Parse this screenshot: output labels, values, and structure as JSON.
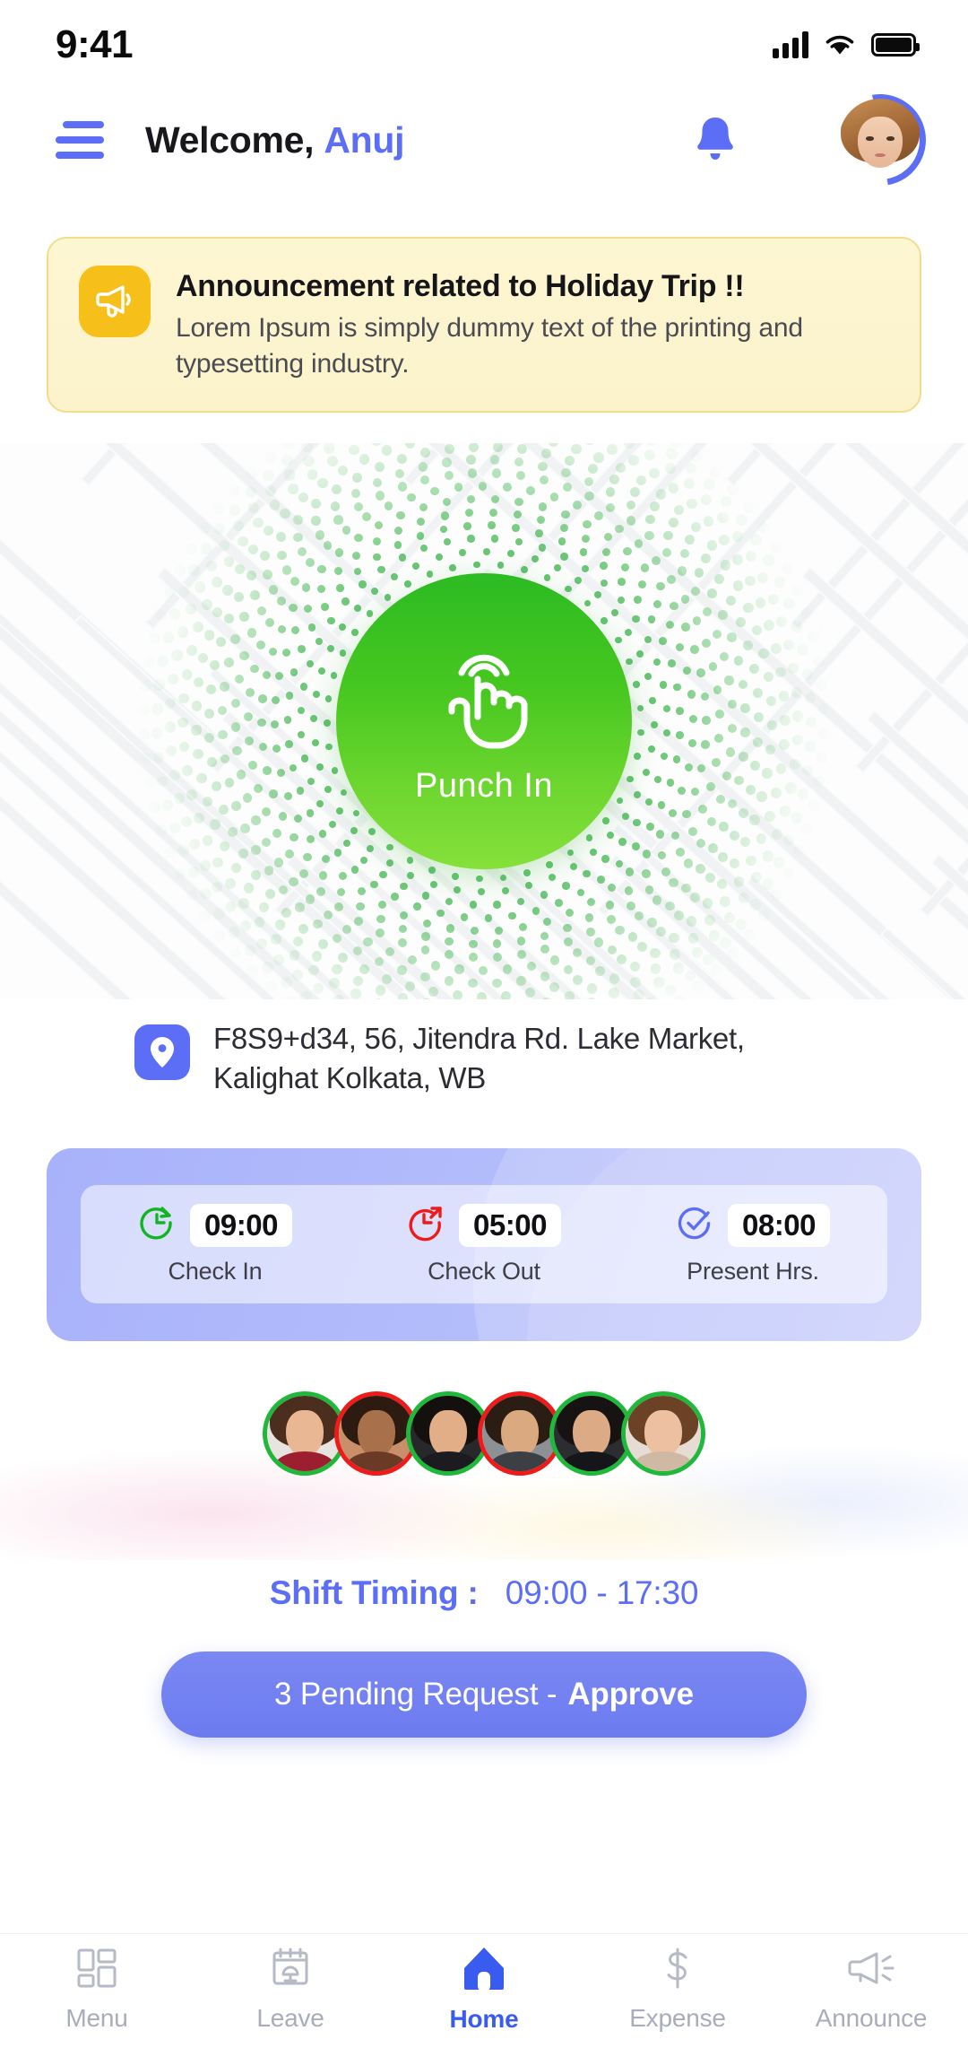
{
  "status_bar": {
    "time": "9:41",
    "signal_icon": "signal-bars-icon",
    "wifi_icon": "wifi-icon",
    "battery_icon": "battery-full-icon"
  },
  "header": {
    "menu_icon": "hamburger-menu-icon",
    "greeting": "Welcome,",
    "user_name": "Anuj",
    "bell_icon": "notification-bell-icon",
    "avatar_icon": "user-avatar"
  },
  "announcement": {
    "icon": "megaphone-icon",
    "title": "Announcement related to Holiday Trip !!",
    "body": "Lorem Ipsum is simply dummy text of the printing and typesetting industry."
  },
  "punch": {
    "icon": "tap-hand-icon",
    "label": "Punch In"
  },
  "address": {
    "pin_icon": "location-pin-icon",
    "line1": "F8S9+d34, 56, Jitendra Rd. Lake Market,",
    "line2": "Kalighat Kolkata, WB"
  },
  "attendance": [
    {
      "icon": "clock-arrow-in-icon",
      "value": "09:00",
      "label": "Check In",
      "color": "#12b521"
    },
    {
      "icon": "clock-arrow-out-icon",
      "value": "05:00",
      "label": "Check Out",
      "color": "#ef1b1b"
    },
    {
      "icon": "clock-check-icon",
      "value": "08:00",
      "label": "Present Hrs.",
      "color": "#5b6ef5"
    }
  ],
  "team_avatars": [
    {
      "name": "team-member-1",
      "status": "present",
      "ring": "#1fb83a",
      "hair": "#4b2e1d",
      "skin": "#e9b793",
      "body": "#9c1f30",
      "bg": "#e8e4e0"
    },
    {
      "name": "team-member-2",
      "status": "absent",
      "ring": "#ef1b1b",
      "hair": "#2d1b12",
      "skin": "#a9714b",
      "body": "#6b3a26",
      "bg": "#c98f6a"
    },
    {
      "name": "team-member-3",
      "status": "present",
      "ring": "#1fb83a",
      "hair": "#14100e",
      "skin": "#e2ae88",
      "body": "#1c1c20",
      "bg": "#26282a"
    },
    {
      "name": "team-member-4",
      "status": "absent",
      "ring": "#ef1b1b",
      "hair": "#2b1d14",
      "skin": "#dba980",
      "body": "#3c3f43",
      "bg": "#8d9095"
    },
    {
      "name": "team-member-5",
      "status": "present",
      "ring": "#1fb83a",
      "hair": "#171312",
      "skin": "#dcaa85",
      "body": "#14161a",
      "bg": "#2b2d31"
    },
    {
      "name": "team-member-6",
      "status": "present",
      "ring": "#1fb83a",
      "hair": "#6b4226",
      "skin": "#ecc0a0",
      "body": "#cfb8a4",
      "bg": "#e6dcd4"
    }
  ],
  "shift": {
    "label": "Shift Timing :",
    "value": "09:00 - 17:30"
  },
  "approve_button": {
    "prefix": "3 Pending Request -",
    "action": "Approve"
  },
  "bottom_nav": [
    {
      "icon": "grid-layout-icon",
      "label": "Menu",
      "active": false
    },
    {
      "icon": "calendar-leave-icon",
      "label": "Leave",
      "active": false
    },
    {
      "icon": "home-icon",
      "label": "Home",
      "active": true
    },
    {
      "icon": "dollar-sign-icon",
      "label": "Expense",
      "active": false
    },
    {
      "icon": "megaphone-outline-icon",
      "label": "Announce",
      "active": false
    }
  ],
  "colors": {
    "accent": "#5b6ef5",
    "punch_green": "#46c720",
    "announce_bg": "#fdf6d2",
    "announce_icon": "#f7bf19"
  }
}
